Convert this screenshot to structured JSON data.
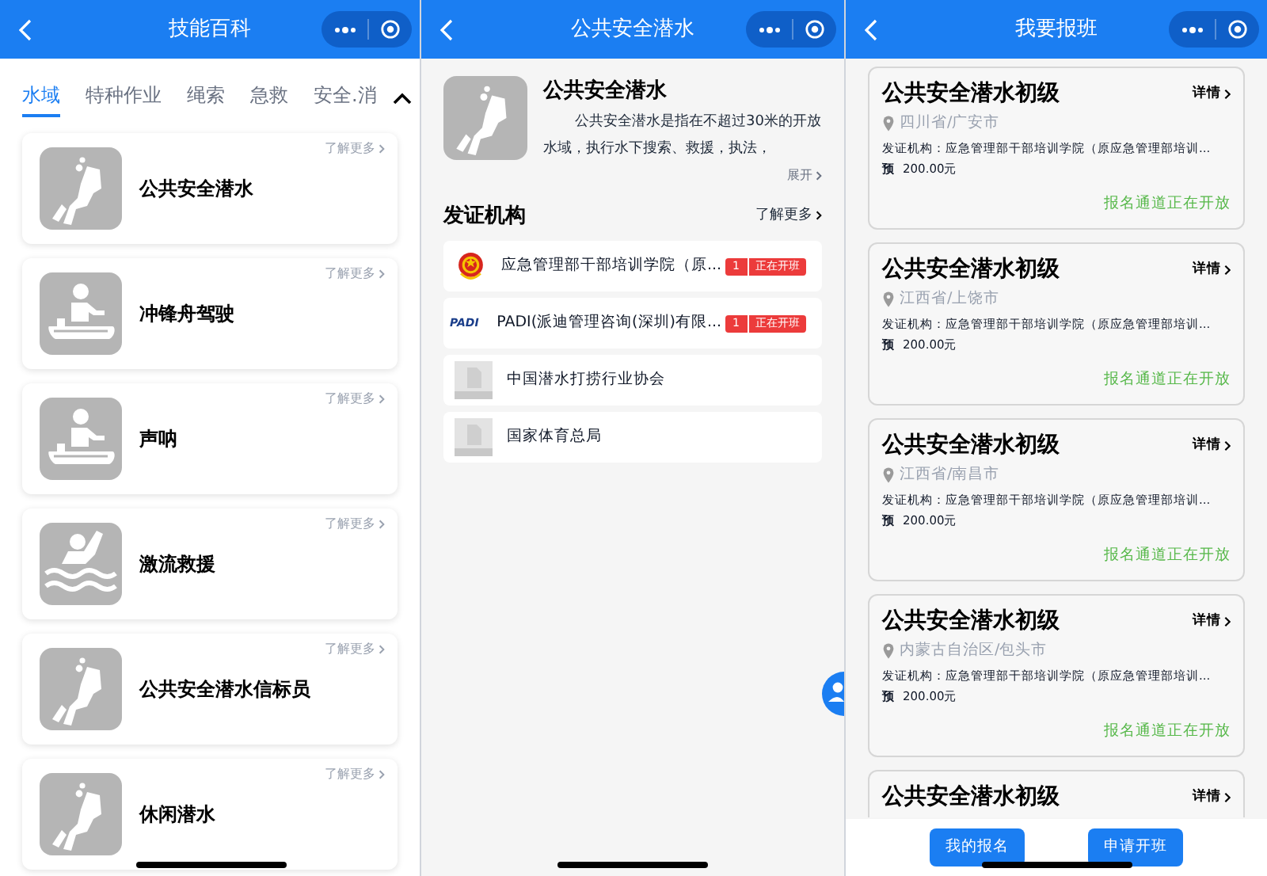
{
  "skills_screen": {
    "title": "技能百科",
    "tabs": [
      {
        "label": "水域",
        "selected": true
      },
      {
        "label": "特种作业",
        "selected": false
      },
      {
        "label": "绳索",
        "selected": false
      },
      {
        "label": "急救",
        "selected": false
      },
      {
        "label": "安全.消",
        "selected": false
      }
    ],
    "cards": [
      {
        "kind": "diver",
        "title": "公共安全潜水",
        "more": "了解更多"
      },
      {
        "kind": "boat",
        "title": "冲锋舟驾驶",
        "more": "了解更多"
      },
      {
        "kind": "boat",
        "title": "声呐",
        "more": "了解更多"
      },
      {
        "kind": "swimmer",
        "title": "激流救援",
        "more": "了解更多"
      },
      {
        "kind": "diver",
        "title": "公共安全潜水信标员",
        "more": "了解更多"
      },
      {
        "kind": "diver",
        "title": "休闲潜水",
        "more": "了解更多"
      }
    ]
  },
  "detail_screen": {
    "title": "公共安全潜水",
    "heading": "公共安全潜水",
    "description": "公共安全潜水是指在不超过30米的开放水域，执行水下搜索、救援，执法，",
    "expand": "展开",
    "section_title": "发证机构",
    "section_more": "了解更多",
    "orgs": [
      {
        "kind": "emblem",
        "name": "应急管理部干部培训学院（原...",
        "count": "1",
        "status": "正在开班"
      },
      {
        "kind": "padi",
        "logo_text": "PADI",
        "name": "PADI(派迪管理咨询(深圳)有限...",
        "count": "1",
        "status": "正在开班"
      },
      {
        "kind": "placeholder",
        "name": "中国潜水打捞行业协会"
      },
      {
        "kind": "placeholder",
        "name": "国家体育总局"
      }
    ]
  },
  "enroll_screen": {
    "title": "我要报班",
    "courses": [
      {
        "title": "公共安全潜水初级",
        "details": "详情",
        "location": "四川省/广安市",
        "org": "发证机构：应急管理部干部培训学院（原应急管理部培训...",
        "price_label": "预",
        "price": "200.00元",
        "status": "报名通道正在开放"
      },
      {
        "title": "公共安全潜水初级",
        "details": "详情",
        "location": "江西省/上饶市",
        "org": "发证机构：应急管理部干部培训学院（原应急管理部培训...",
        "price_label": "预",
        "price": "200.00元",
        "status": "报名通道正在开放"
      },
      {
        "title": "公共安全潜水初级",
        "details": "详情",
        "location": "江西省/南昌市",
        "org": "发证机构：应急管理部干部培训学院（原应急管理部培训...",
        "price_label": "预",
        "price": "200.00元",
        "status": "报名通道正在开放"
      },
      {
        "title": "公共安全潜水初级",
        "details": "详情",
        "location": "内蒙古自治区/包头市",
        "org": "发证机构：应急管理部干部培训学院（原应急管理部培训...",
        "price_label": "预",
        "price": "200.00元",
        "status": "报名通道正在开放"
      },
      {
        "title": "公共安全潜水初级",
        "details": "详情"
      }
    ],
    "buttons": [
      "我的报名",
      "申请开班"
    ]
  }
}
